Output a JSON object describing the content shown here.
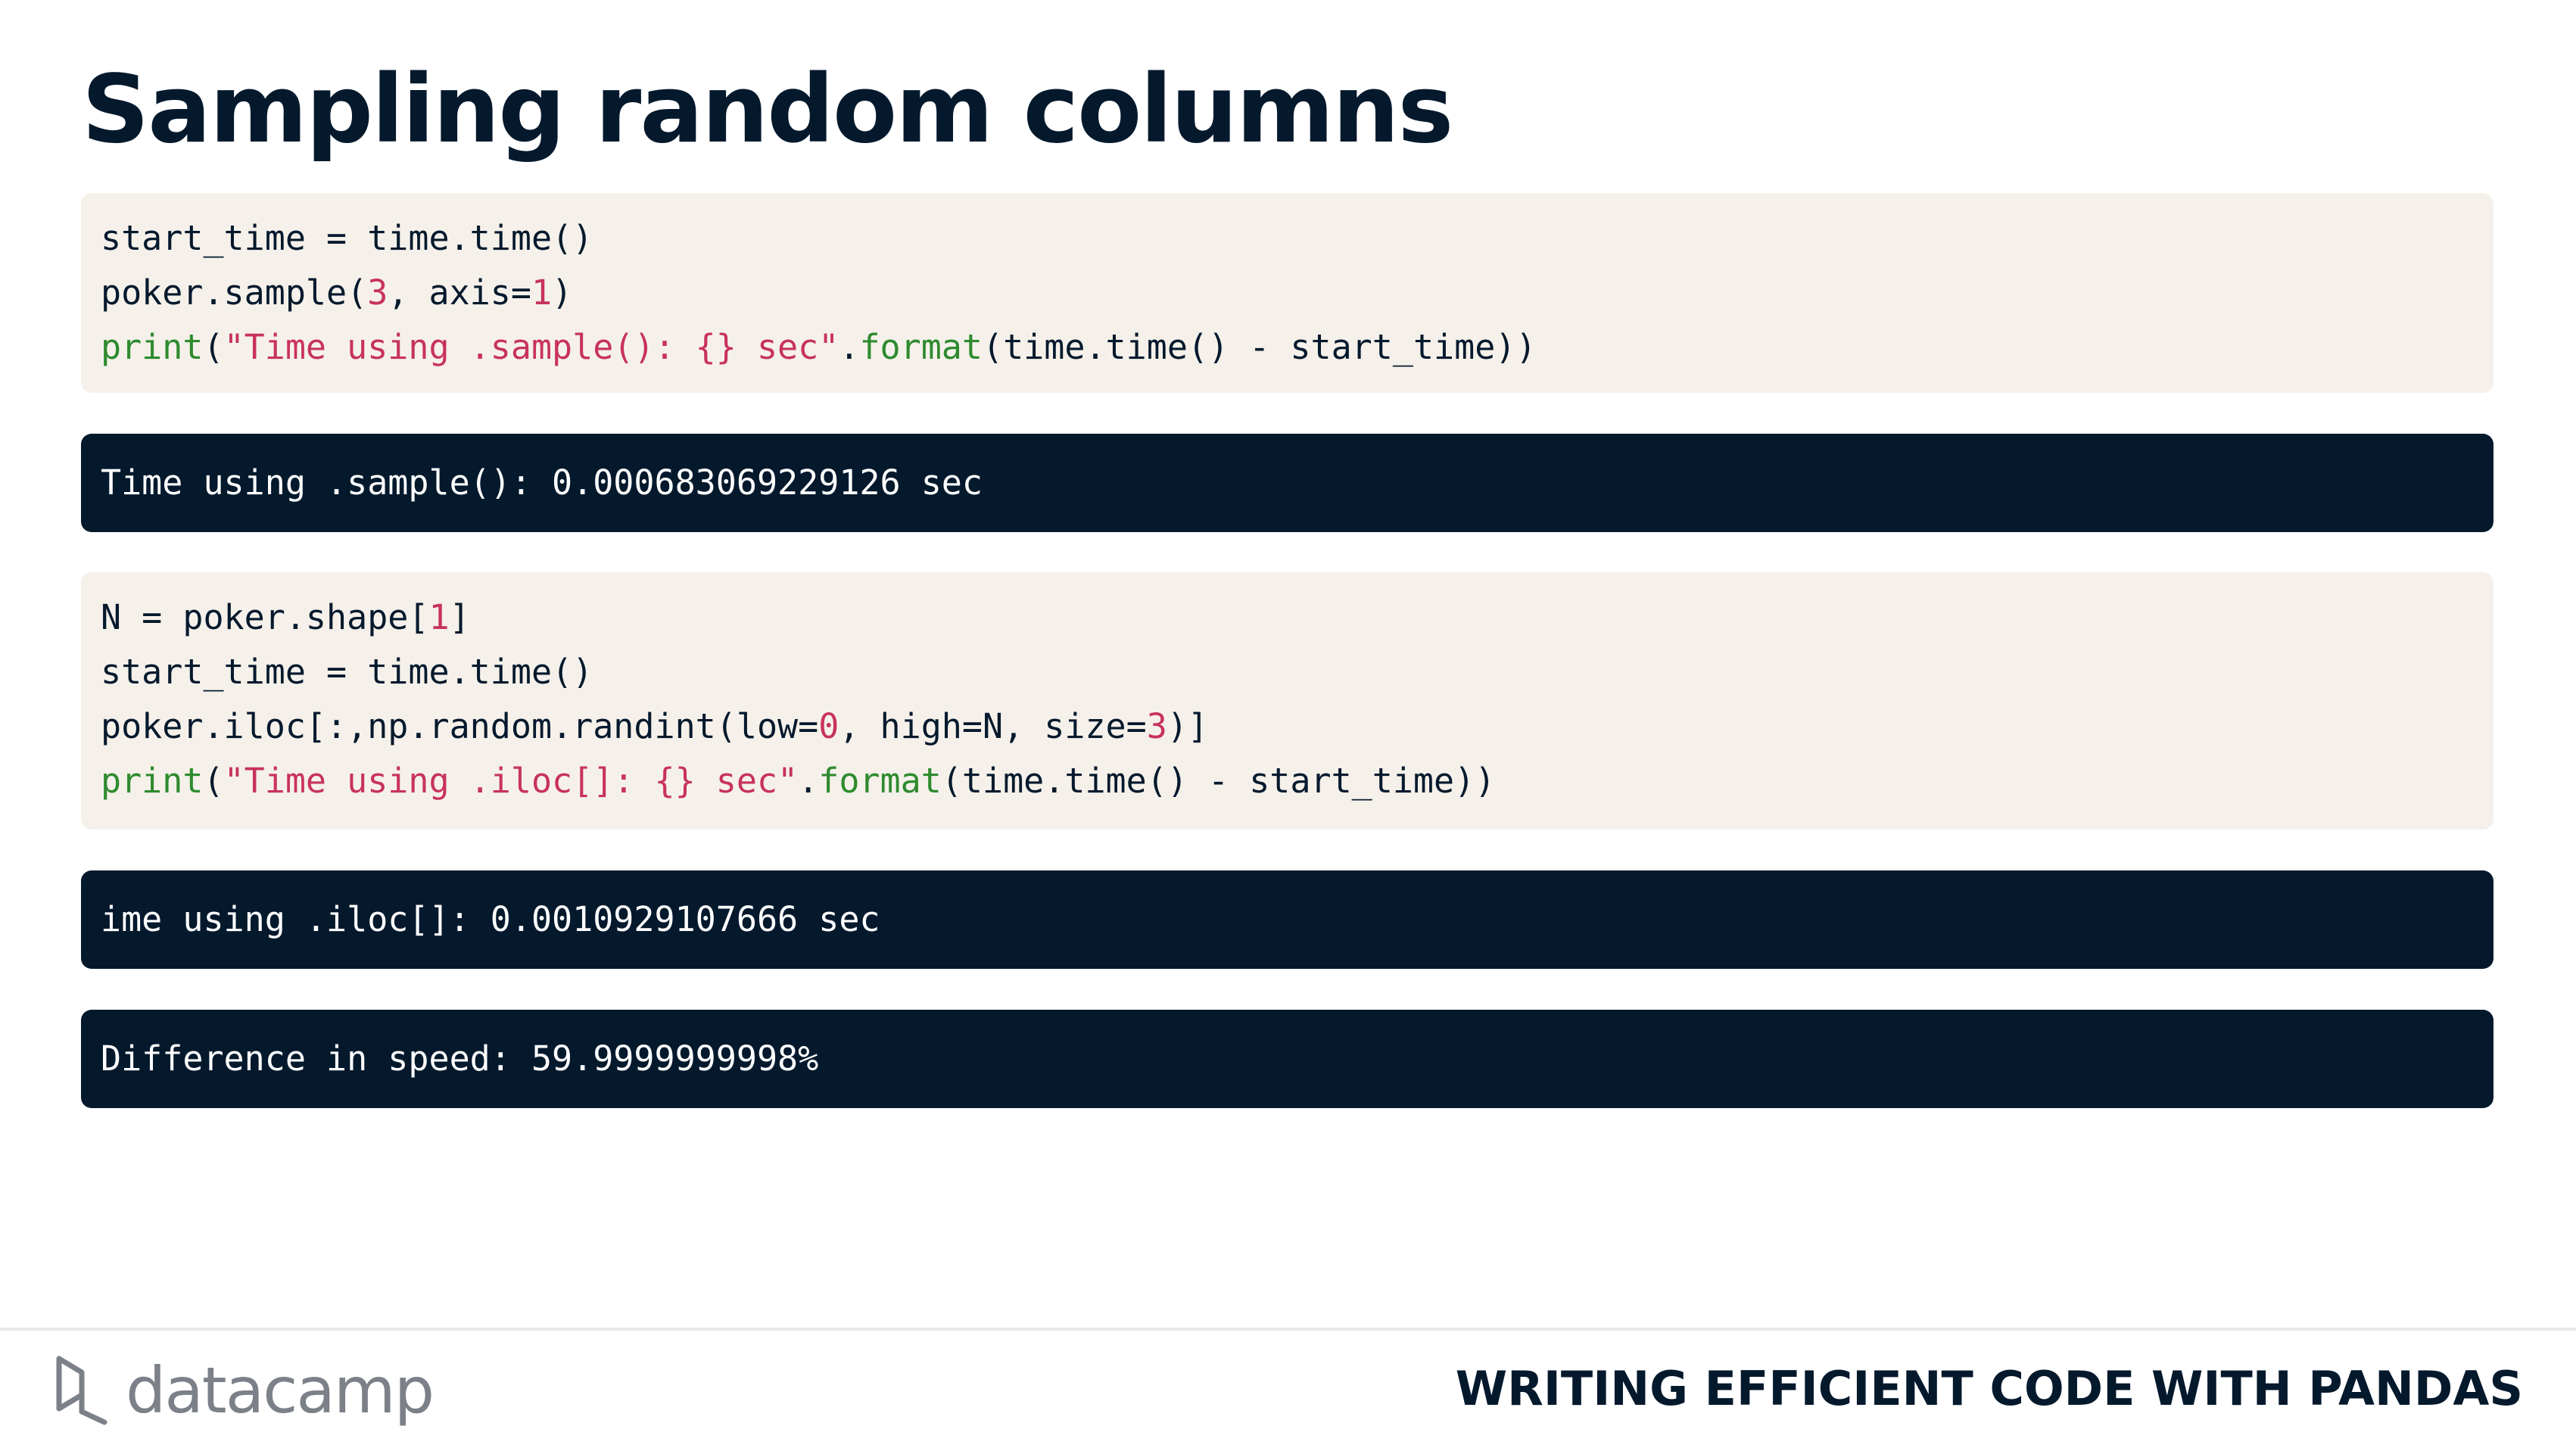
{
  "slide": {
    "title": "Sampling random columns"
  },
  "code_block_1": {
    "lines": [
      [
        {
          "t": "start_time = time.time()",
          "k": "plain"
        }
      ],
      [
        {
          "t": "poker.sample(",
          "k": "plain"
        },
        {
          "t": "3",
          "k": "num"
        },
        {
          "t": ", axis=",
          "k": "plain"
        },
        {
          "t": "1",
          "k": "num"
        },
        {
          "t": ")",
          "k": "plain"
        }
      ],
      [
        {
          "t": "print",
          "k": "fn"
        },
        {
          "t": "(",
          "k": "plain"
        },
        {
          "t": "\"Time using .sample(): {} sec\"",
          "k": "str"
        },
        {
          "t": ".",
          "k": "plain"
        },
        {
          "t": "format",
          "k": "fn"
        },
        {
          "t": "(time.time() - start_time))",
          "k": "plain"
        }
      ]
    ]
  },
  "output_1": {
    "text": "Time using .sample(): 0.000683069229126 sec"
  },
  "code_block_2": {
    "lines": [
      [
        {
          "t": "N = poker.shape[",
          "k": "plain"
        },
        {
          "t": "1",
          "k": "num"
        },
        {
          "t": "]",
          "k": "plain"
        }
      ],
      [
        {
          "t": "start_time = time.time()",
          "k": "plain"
        }
      ],
      [
        {
          "t": "poker.iloc[:,np.random.randint(low=",
          "k": "plain"
        },
        {
          "t": "0",
          "k": "num"
        },
        {
          "t": ", high=N, size=",
          "k": "plain"
        },
        {
          "t": "3",
          "k": "num"
        },
        {
          "t": ")]",
          "k": "plain"
        }
      ],
      [
        {
          "t": "print",
          "k": "fn"
        },
        {
          "t": "(",
          "k": "plain"
        },
        {
          "t": "\"Time using .iloc[]: {} sec\"",
          "k": "str"
        },
        {
          "t": ".",
          "k": "plain"
        },
        {
          "t": "format",
          "k": "fn"
        },
        {
          "t": "(time.time() - start_time))",
          "k": "plain"
        }
      ]
    ]
  },
  "output_2": {
    "text": "ime using .iloc[]: 0.0010929107666 sec"
  },
  "output_3": {
    "text": "Difference in speed: 59.9999999998%"
  },
  "footer": {
    "logo_text": "datacamp",
    "course_title": "WRITING EFFICIENT CODE WITH PANDAS"
  },
  "colors": {
    "title": "#05192d",
    "code_background": "#f5f1ea",
    "output_background": "#05192d",
    "number_token": "#c8325f",
    "string_token": "#c8325f",
    "function_token": "#2e8b2e",
    "logo": "#7c8088"
  },
  "icons": {
    "logo": "datacamp-logo-icon"
  }
}
